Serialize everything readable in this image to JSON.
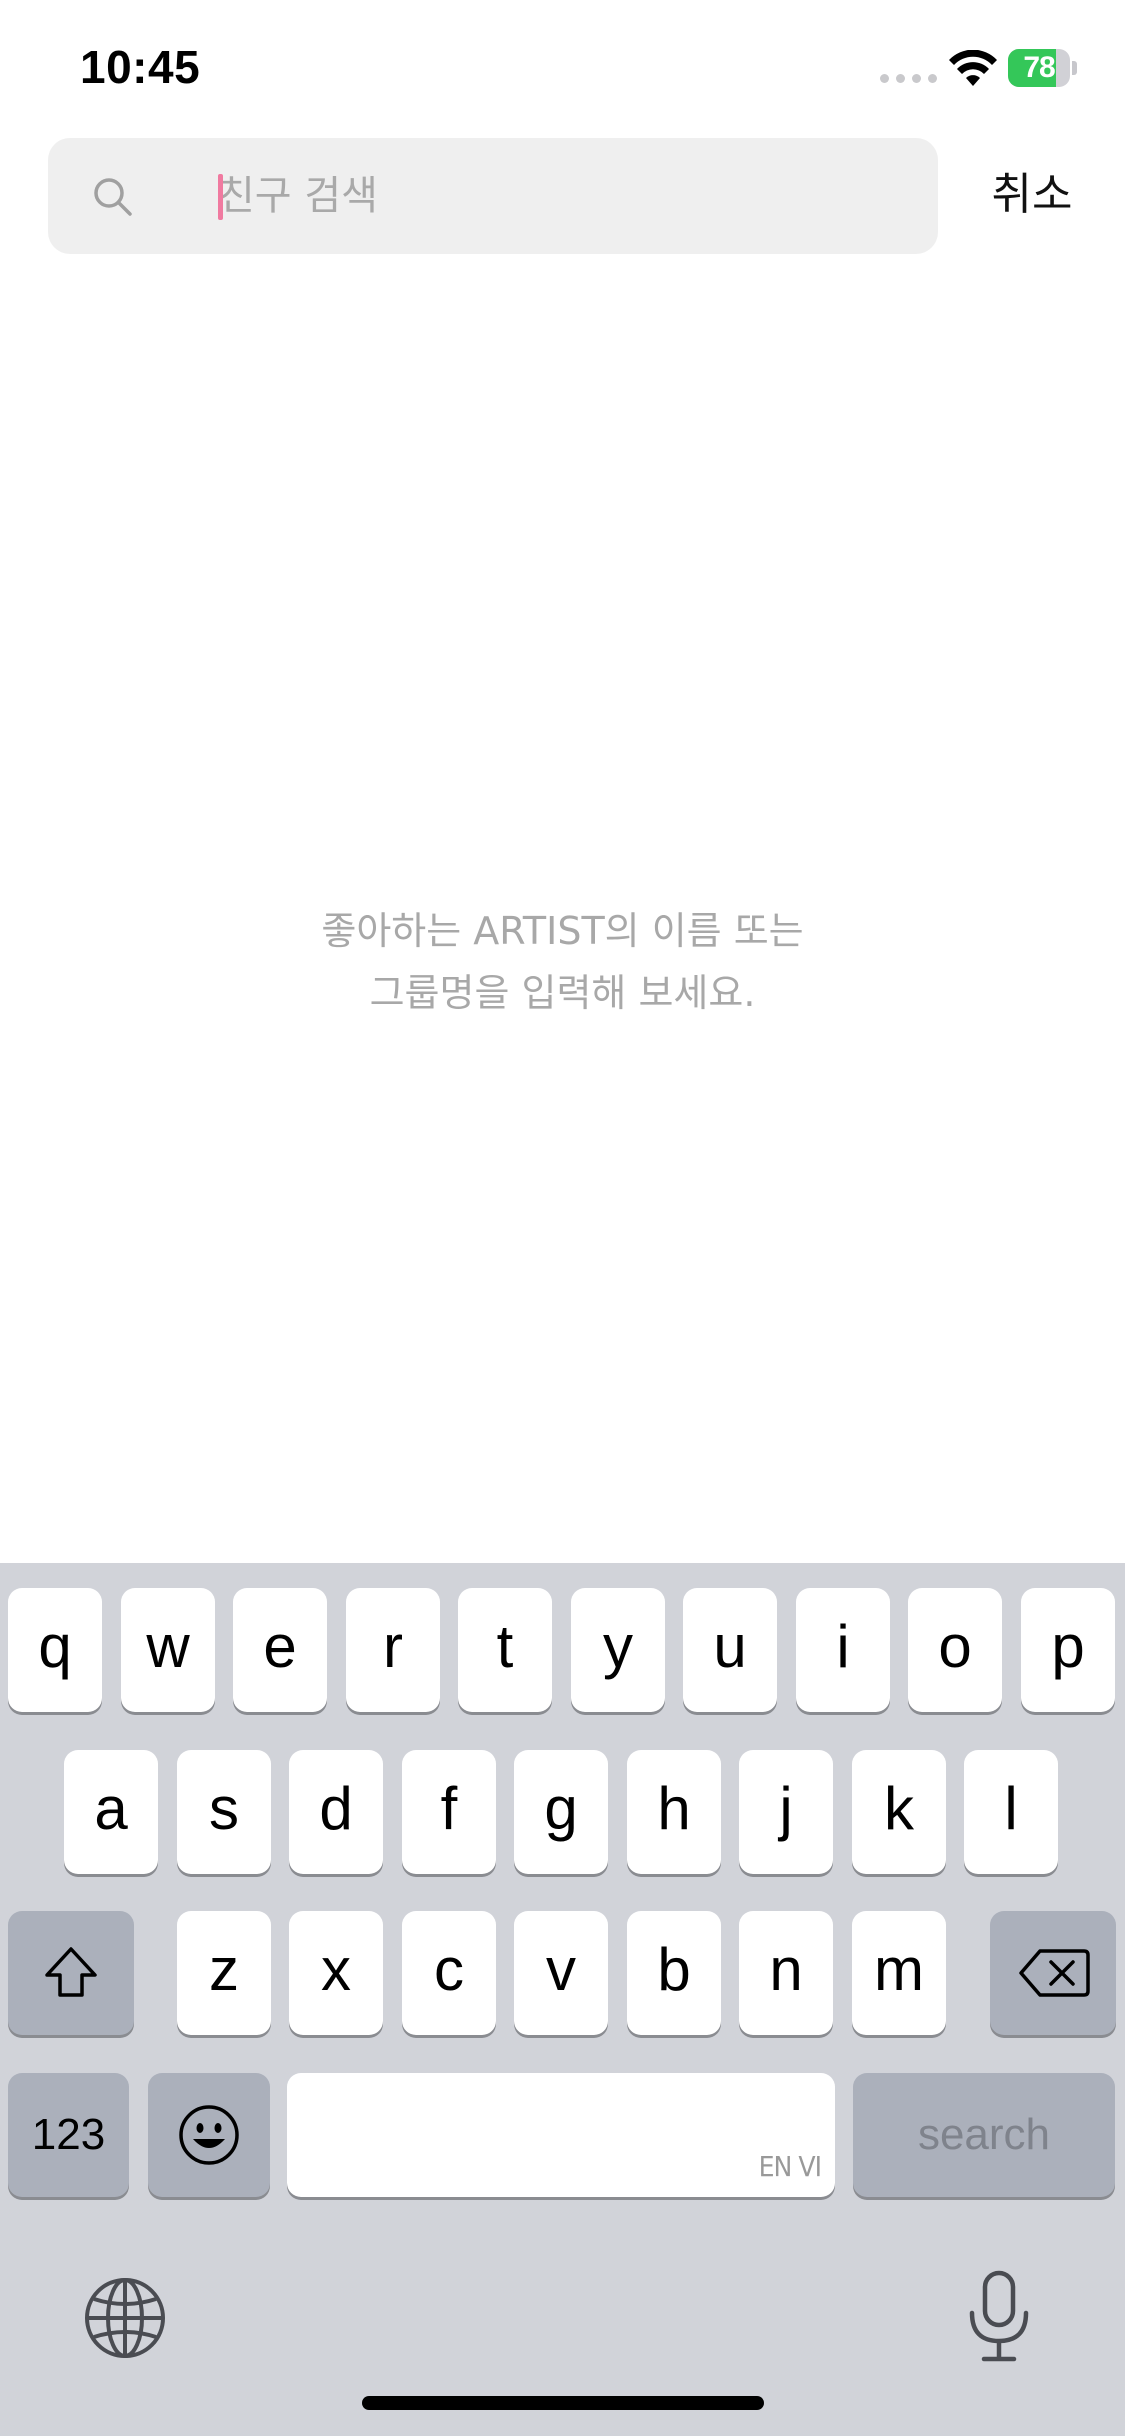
{
  "status_bar": {
    "time": "10:45",
    "battery_level": "78",
    "battery_percent": 78,
    "battery_charging": true,
    "icons": [
      "cellular-signal-icon",
      "wifi-icon",
      "battery-icon"
    ]
  },
  "search": {
    "placeholder": "친구 검색",
    "value": "",
    "icon": "search-icon",
    "cancel_label": "취소"
  },
  "empty_state": {
    "line1": "좋아하는 ARTIST의 이름 또는",
    "line2": "그룹명을 입력해 보세요."
  },
  "keyboard": {
    "row1": [
      "q",
      "w",
      "e",
      "r",
      "t",
      "y",
      "u",
      "i",
      "o",
      "p"
    ],
    "row2": [
      "a",
      "s",
      "d",
      "f",
      "g",
      "h",
      "j",
      "k",
      "l"
    ],
    "row3": [
      "z",
      "x",
      "c",
      "v",
      "b",
      "n",
      "m"
    ],
    "numbers_label": "123",
    "space_languages": "EN VI",
    "return_label": "search",
    "icons": [
      "shift-icon",
      "delete-icon",
      "emoji-icon",
      "globe-icon",
      "microphone-icon"
    ]
  },
  "colors": {
    "caret": "#f07aa0",
    "battery_fill": "#34c759",
    "keyboard_bg": "#d1d3d9",
    "hint_text": "#a8a8a8"
  }
}
